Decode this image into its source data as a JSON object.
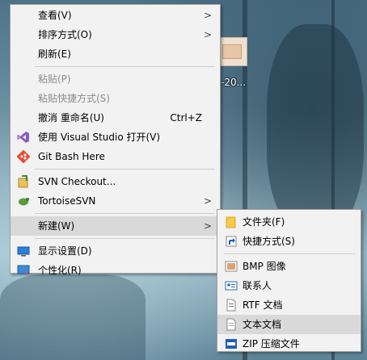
{
  "desktop": {
    "icon_label": "ge-20..."
  },
  "context_menu": {
    "items": [
      {
        "label": "查看(V)"
      },
      {
        "label": "排序方式(O)"
      },
      {
        "label": "刷新(E)"
      },
      {
        "label": "粘贴(P)"
      },
      {
        "label": "粘贴快捷方式(S)"
      },
      {
        "label": "撤消 重命名(U)",
        "shortcut": "Ctrl+Z"
      },
      {
        "label": "使用 Visual Studio 打开(V)"
      },
      {
        "label": "Git Bash Here"
      },
      {
        "label": "SVN Checkout..."
      },
      {
        "label": "TortoiseSVN"
      },
      {
        "label": "新建(W)"
      },
      {
        "label": "显示设置(D)"
      },
      {
        "label": "个性化(R)"
      }
    ]
  },
  "new_submenu": {
    "items": [
      {
        "label": "文件夹(F)"
      },
      {
        "label": "快捷方式(S)"
      },
      {
        "label": "BMP 图像"
      },
      {
        "label": "联系人"
      },
      {
        "label": "RTF 文档"
      },
      {
        "label": "文本文档"
      },
      {
        "label": "ZIP 压缩文件"
      }
    ]
  },
  "icons": {
    "visual_studio": "#865fc5",
    "folder": "#f5c94b",
    "zip": "#1e5fb4"
  }
}
